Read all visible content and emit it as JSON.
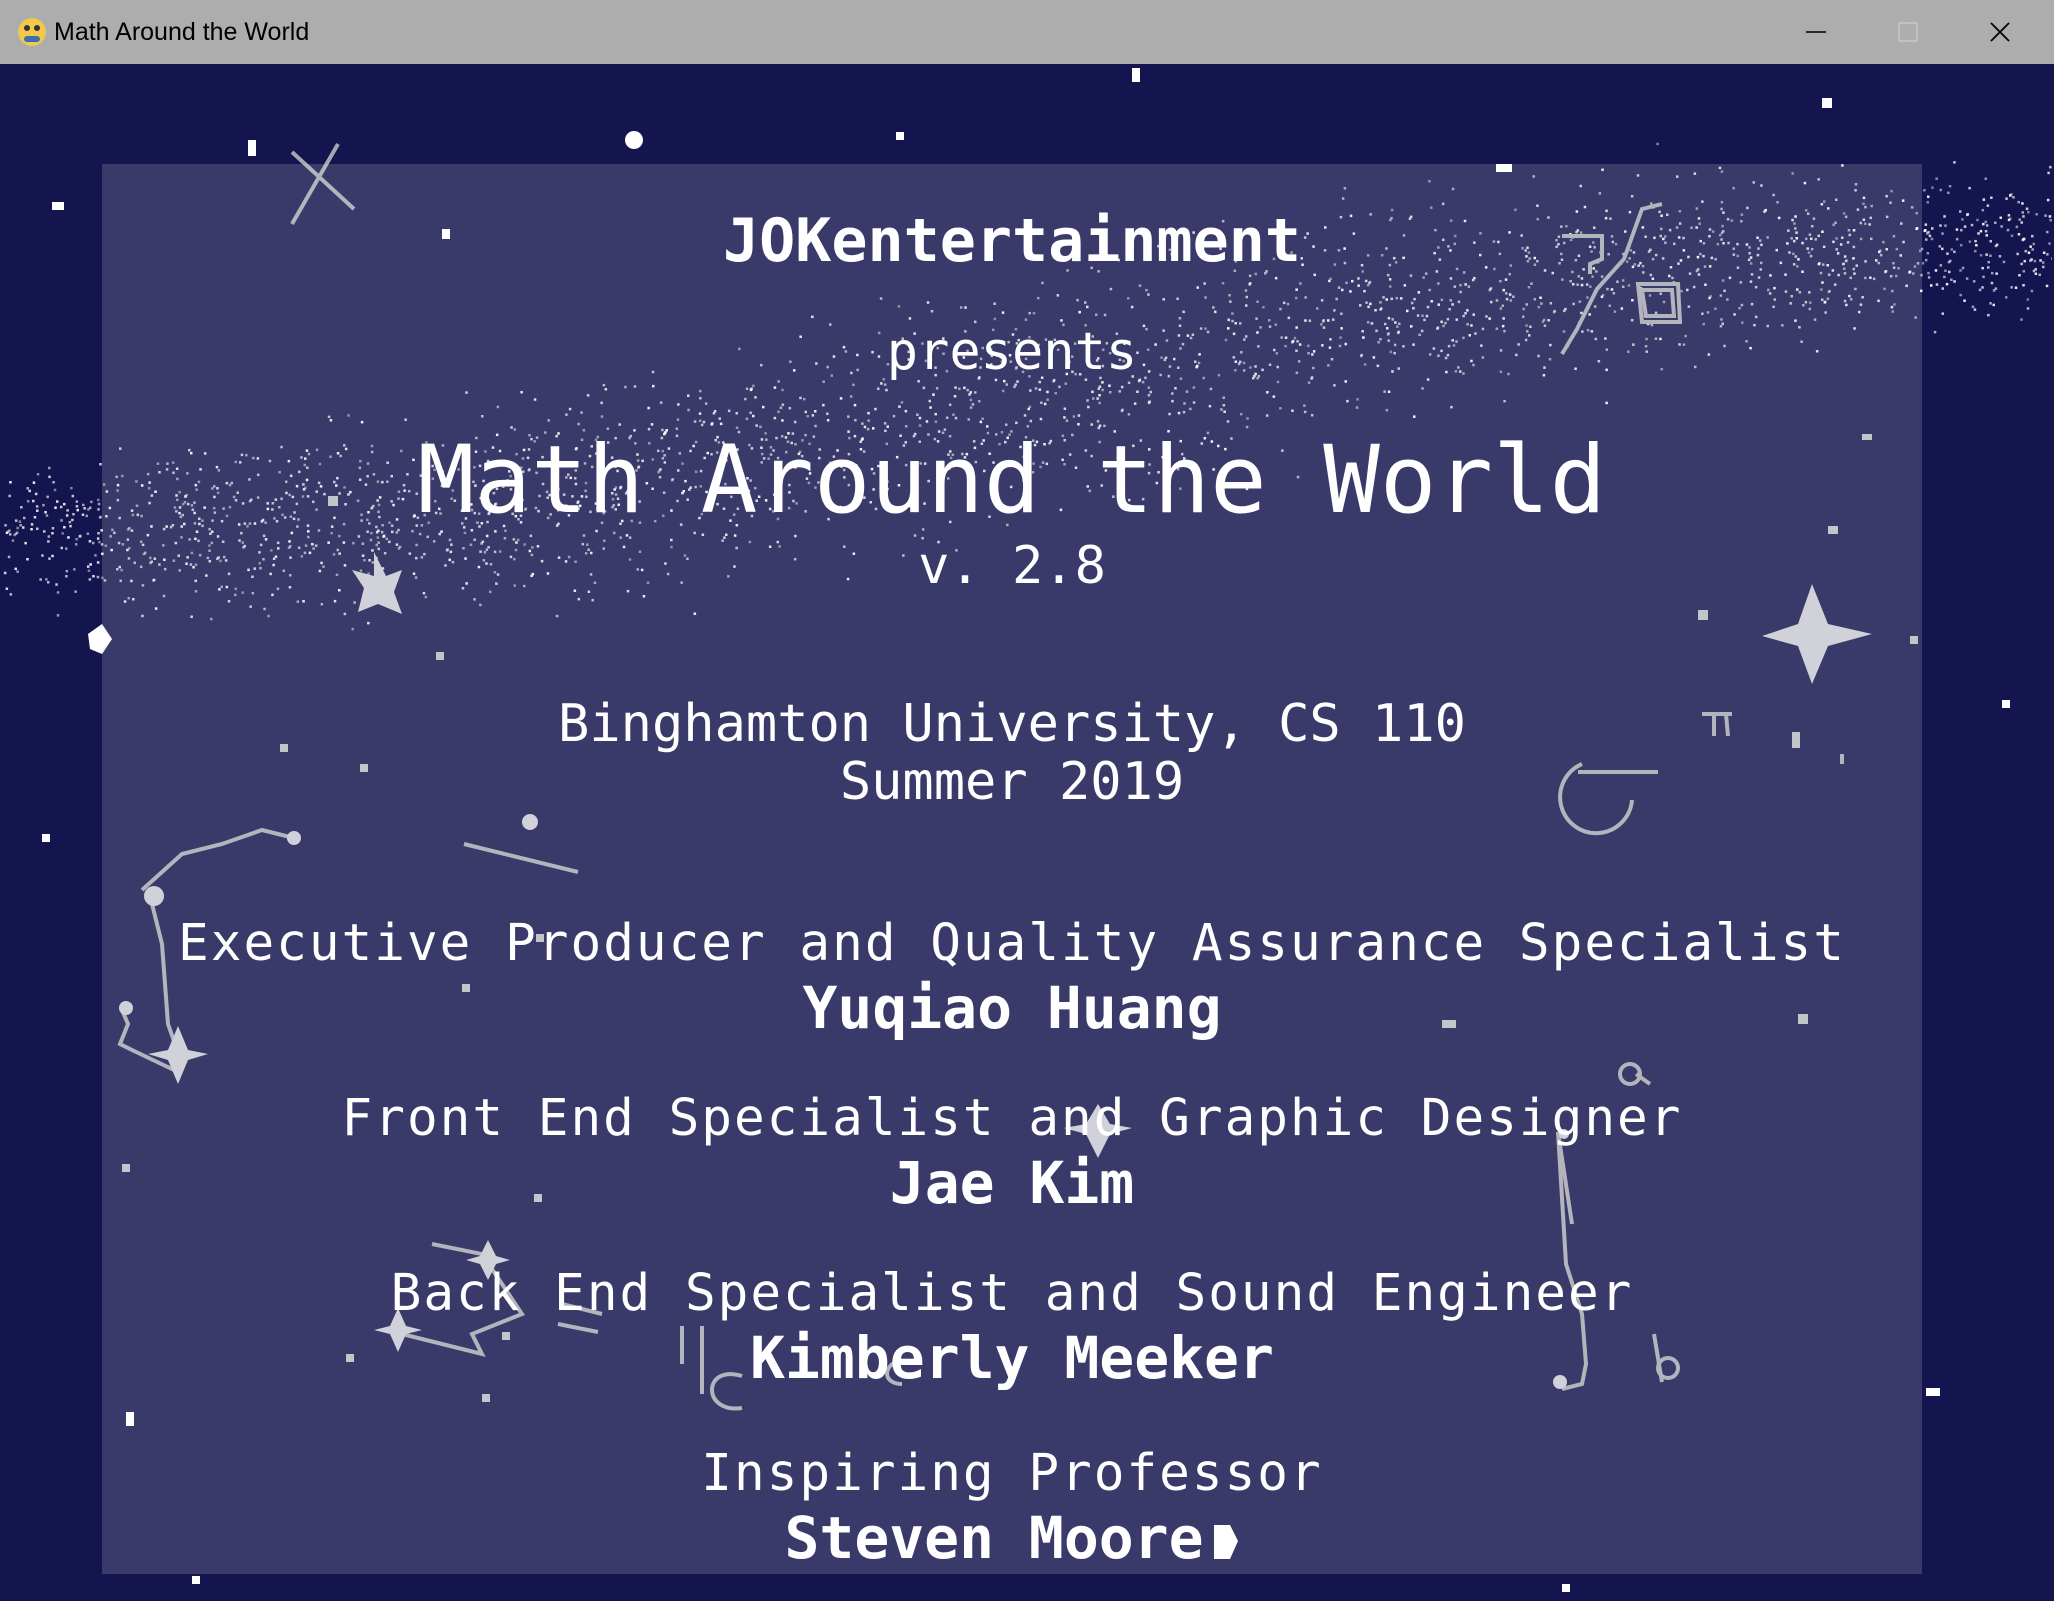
{
  "window": {
    "title": "Math Around the World",
    "app_icon": "python-icon",
    "controls": [
      "minimize-icon",
      "maximize-icon",
      "close-icon"
    ]
  },
  "credits": {
    "company": "JOKentertainment",
    "presents": "presents",
    "game_title": "Math Around the World",
    "version": "v. 2.8",
    "institution": "Binghamton University, CS 110",
    "term": "Summer 2019",
    "staff": [
      {
        "role": "Executive Producer and Quality Assurance Specialist",
        "name": "Yuqiao Huang"
      },
      {
        "role": "Front End Specialist and Graphic Designer",
        "name": "Jae Kim"
      },
      {
        "role": "Back End Specialist and Sound Engineer",
        "name": "Kimberly Meeker"
      },
      {
        "role": "Inspiring Professor",
        "name": "Steven Moore"
      }
    ]
  },
  "colors": {
    "sky": "#14144e",
    "panel_overlay": "#ffffff",
    "titlebar": "#adadad",
    "text": "#ffffff",
    "doodles": "#a6a6b0"
  }
}
